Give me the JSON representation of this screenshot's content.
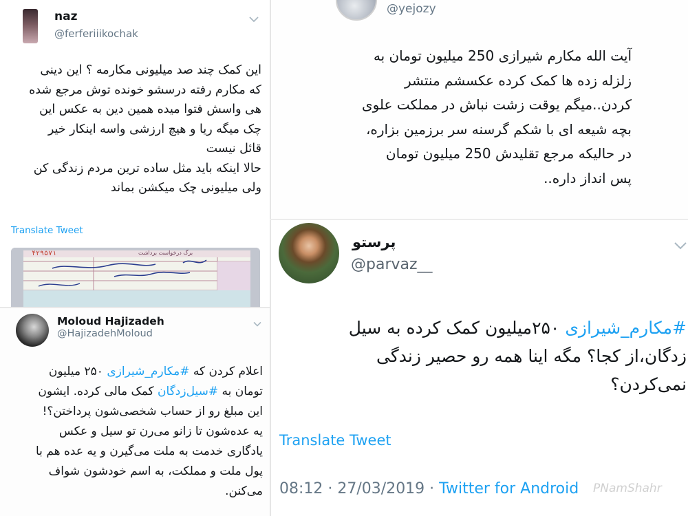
{
  "tweet_naz": {
    "name": "naz",
    "handle": "@ferferiiikochak",
    "lines": [
      "این کمک چند صد میلیونی مکارمه ؟ این دینی",
      "که مکارم رفته درسشو خونده توش مرجع شده",
      "هی واسش فتوا میده همین دین به عکس این",
      "چک میگه ریا و هیچ ارزشی  واسه اینکار خیر",
      "قائل نیست",
      "حالا اینکه باید مثل ساده ترین مردم زندگی کن",
      "ولی میلیونی چک میکشن بماند"
    ],
    "translate": "Translate Tweet",
    "image_icon": "bank-receipt-image",
    "receipt_texts": [
      "برگ درخواست برداشت",
      "۴۲۹۵۷۱"
    ]
  },
  "tweet_moloud": {
    "name": "Moloud Hajizadeh",
    "handle": "@HajizadehMoloud",
    "line1_pre": "اعلام کردن که ",
    "line1_tag": "#مکارم_شیرازی",
    "line1_post": " ۲۵۰ میلیون",
    "line2_pre": "تومان به ",
    "line2_tag": "#سیل‌زدگان",
    "line2_post": " کمک مالی کرده. ایشون",
    "lines_rest": [
      "این مبلغ رو از حساب شخصی‌شون پرداختن؟!",
      "یه عده‌شون تا زانو می‌رن تو سیل و عکس",
      "یادگاری خدمت به ملت می‌گیرن و یه عده هم با",
      "پول ملت و مملکت، به اسم خودشون شواف",
      "می‌کنن."
    ]
  },
  "tweet_yejozy": {
    "handle": "@yejozy",
    "lines": [
      "آیت الله مکارم شیرازی 250 میلیون تومان به",
      "زلزله زده ها کمک کرده عکسشم منتشر",
      "کردن..میگم یوقت زشت نباش در مملکت علوی",
      "بچه شیعه ای با شکم گرسنه سر برزمین بزاره،",
      "در حالیکه مرجع تقلیدش 250 میلیون تومان",
      "پس انداز داره.."
    ]
  },
  "tweet_parvaz": {
    "name": "پرستو",
    "handle": "@parvaz__",
    "line1_tag": "#مکارم_شیرازی",
    "line1_post": " ۲۵۰میلیون کمک کرده به سیل",
    "lines_rest": [
      "زدگان،از کجا؟ مگه اینا همه رو حصیر زندگی",
      "نمی‌کردن؟"
    ],
    "translate": "Translate Tweet",
    "timestamp": "08:12 · 27/03/2019 · ",
    "source": "Twitter for Android",
    "watermark": "PNamShahr"
  },
  "icons": {
    "chevron": "chevron-down-icon"
  },
  "colors": {
    "twitter_blue": "#1da1f2",
    "secondary_text": "#657786"
  }
}
